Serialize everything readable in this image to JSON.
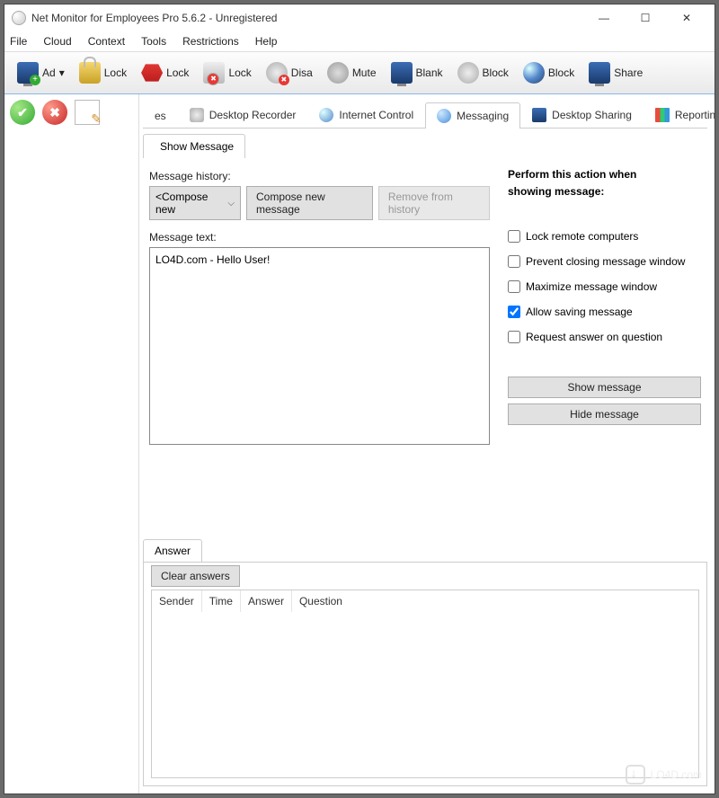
{
  "window": {
    "title": "Net Monitor for Employees Pro 5.6.2 - Unregistered"
  },
  "menu": {
    "items": [
      "File",
      "Cloud",
      "Context",
      "Tools",
      "Restrictions",
      "Help"
    ]
  },
  "toolbar": {
    "items": [
      {
        "icon": "monitor green-plus",
        "label": "Ad",
        "caret": true
      },
      {
        "icon": "padlock",
        "label": "Lock"
      },
      {
        "icon": "usb red-stop",
        "label": "Lock"
      },
      {
        "icon": "printer red-stop",
        "label": "Lock"
      },
      {
        "icon": "gear red-stop",
        "label": "Disa"
      },
      {
        "icon": "speaker",
        "label": "Mute"
      },
      {
        "icon": "monitor",
        "label": "Blank"
      },
      {
        "icon": "gear",
        "label": "Block"
      },
      {
        "icon": "globe",
        "label": "Block"
      },
      {
        "icon": "monitor",
        "label": "Share"
      }
    ]
  },
  "tabs": {
    "prefix_fragment": "es",
    "items": [
      {
        "icon": "recorder",
        "label": "Desktop Recorder",
        "active": false
      },
      {
        "icon": "globe",
        "label": "Internet Control",
        "active": false
      },
      {
        "icon": "bubble",
        "label": "Messaging",
        "active": true
      },
      {
        "icon": "monitor",
        "label": "Desktop Sharing",
        "active": false
      },
      {
        "icon": "bars",
        "label": "Reporting",
        "active": false
      }
    ]
  },
  "subtab": {
    "label": "Show Message"
  },
  "messaging": {
    "history_label": "Message history:",
    "compose_dropdown": "<Compose new",
    "compose_button": "Compose new message",
    "remove_button": "Remove from history",
    "text_label": "Message text:",
    "text_value": "LO4D.com - Hello User!"
  },
  "actions": {
    "title_line1": "Perform this action when",
    "title_line2": "showing message:",
    "checks": [
      {
        "label": "Lock remote computers",
        "checked": false
      },
      {
        "label": "Prevent closing message window",
        "checked": false
      },
      {
        "label": "Maximize message window",
        "checked": false
      },
      {
        "label": "Allow saving message",
        "checked": true
      },
      {
        "label": "Request answer on question",
        "checked": false
      }
    ],
    "show_button": "Show message",
    "hide_button": "Hide message"
  },
  "answer": {
    "tab_label": "Answer",
    "clear_button": "Clear answers",
    "columns": [
      "Sender",
      "Time",
      "Answer",
      "Question"
    ]
  },
  "watermark": "LO4D.com"
}
